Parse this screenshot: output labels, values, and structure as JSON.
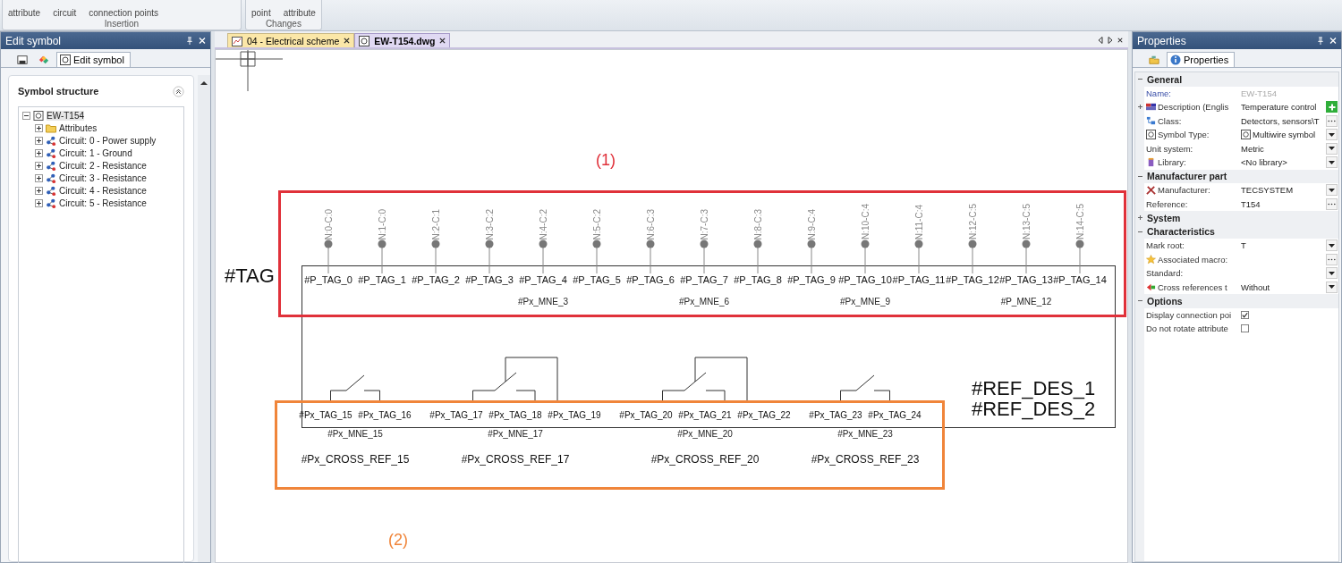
{
  "ribbon": {
    "groups": [
      {
        "label": "Insertion",
        "buttons": [
          "attribute",
          "circuit",
          "connection points"
        ]
      },
      {
        "label": "Changes",
        "buttons": [
          "point",
          "attribute"
        ]
      }
    ]
  },
  "edit_panel": {
    "title": "Edit symbol",
    "tabs": [
      {
        "kind": "disk",
        "selected": false
      },
      {
        "kind": "palette",
        "selected": false
      },
      {
        "kind": "edit",
        "label": "Edit symbol",
        "selected": true
      }
    ],
    "structure_title": "Symbol structure",
    "tree": [
      {
        "label": "EW-T154",
        "kind": "symbol",
        "expanded": true,
        "selected": true,
        "children": [
          {
            "label": "Attributes",
            "kind": "folder",
            "expanded": false,
            "selected": false
          },
          {
            "label": "Circuit: 0 - Power supply",
            "kind": "circuit",
            "expanded": false,
            "selected": false
          },
          {
            "label": "Circuit: 1 - Ground",
            "kind": "circuit",
            "expanded": false,
            "selected": false
          },
          {
            "label": "Circuit: 2 - Resistance",
            "kind": "circuit",
            "expanded": false,
            "selected": false
          },
          {
            "label": "Circuit: 3 - Resistance",
            "kind": "circuit",
            "expanded": false,
            "selected": false
          },
          {
            "label": "Circuit: 4 - Resistance",
            "kind": "circuit",
            "expanded": false,
            "selected": false
          },
          {
            "label": "Circuit: 5 - Resistance",
            "kind": "circuit",
            "expanded": false,
            "selected": false
          }
        ]
      }
    ]
  },
  "document_tabs": [
    {
      "label": "04 - Electrical scheme",
      "kind": "scheme",
      "selected": false
    },
    {
      "label": "EW-T154.dwg",
      "kind": "symbol",
      "selected": true
    }
  ],
  "canvas": {
    "highlights": [
      {
        "label": "(1)",
        "color": "#e0313a"
      },
      {
        "label": "(2)",
        "color": "#f0853a"
      }
    ],
    "tag_label": "#TAG",
    "pin_groups": [
      {
        "pins": [
          {
            "node": "N:0-C:0",
            "tag": "#P_TAG_0"
          },
          {
            "node": "N:1-C:0",
            "tag": "#P_TAG_1"
          },
          {
            "node": "N:2-C:1",
            "tag": "#P_TAG_2"
          }
        ]
      },
      {
        "mne": "#Px_MNE_3",
        "pins": [
          {
            "node": "N:3-C:2",
            "tag": "#P_TAG_3"
          },
          {
            "node": "N:4-C:2",
            "tag": "#P_TAG_4"
          },
          {
            "node": "N:5-C:2",
            "tag": "#P_TAG_5"
          }
        ]
      },
      {
        "mne": "#Px_MNE_6",
        "pins": [
          {
            "node": "N:6-C:3",
            "tag": "#P_TAG_6"
          },
          {
            "node": "N:7-C:3",
            "tag": "#P_TAG_7"
          },
          {
            "node": "N:8-C:3",
            "tag": "#P_TAG_8"
          }
        ]
      },
      {
        "mne": "#Px_MNE_9",
        "pins": [
          {
            "node": "N:9-C:4",
            "tag": "#P_TAG_9"
          },
          {
            "node": "N:10-C:4",
            "tag": "#P_TAG_10"
          },
          {
            "node": "N:11-C:4",
            "tag": "#P_TAG_11"
          }
        ]
      },
      {
        "mne": "#P_MNE_12",
        "pins": [
          {
            "node": "N:12-C:5",
            "tag": "#P_TAG_12"
          },
          {
            "node": "N:13-C:5",
            "tag": "#P_TAG_13"
          },
          {
            "node": "N:14-C:5",
            "tag": "#P_TAG_14"
          }
        ]
      }
    ],
    "contacts": [
      {
        "kind": "simple",
        "tags": [
          "#Px_TAG_15",
          "#Px_TAG_16"
        ],
        "mne": "#Px_MNE_15",
        "cross_ref": "#Px_CROSS_REF_15"
      },
      {
        "kind": "boxed",
        "tags": [
          "#Px_TAG_17",
          "#Px_TAG_18",
          "#Px_TAG_19"
        ],
        "mne": "#Px_MNE_17",
        "cross_ref": "#Px_CROSS_REF_17"
      },
      {
        "kind": "boxed",
        "tags": [
          "#Px_TAG_20",
          "#Px_TAG_21",
          "#Px_TAG_22"
        ],
        "mne": "#Px_MNE_20",
        "cross_ref": "#Px_CROSS_REF_20"
      },
      {
        "kind": "simple",
        "tags": [
          "#Px_TAG_23",
          "#Px_TAG_24"
        ],
        "mne": "#Px_MNE_23",
        "cross_ref": "#Px_CROSS_REF_23"
      }
    ],
    "ref_des": [
      "#REF_DES_1",
      "#REF_DES_2"
    ]
  },
  "properties": {
    "title": "Properties",
    "tabs": [
      {
        "kind": "folders",
        "selected": false
      },
      {
        "kind": "info",
        "label": "Properties",
        "selected": true
      }
    ],
    "sections": [
      {
        "label": "General",
        "expanded": true,
        "rows": [
          {
            "label": "Name:",
            "value": "EW-T154",
            "kind": "readonly"
          },
          {
            "label": "Description (Englis",
            "value": "Temperature control",
            "kind": "add",
            "expanded": false
          },
          {
            "label": "Class:",
            "value": "Detectors, sensors\\T",
            "kind": "browse"
          },
          {
            "label": "Symbol Type:",
            "value": "Multiwire symbol",
            "kind": "dropdown"
          },
          {
            "label": "Unit system:",
            "value": "Metric",
            "kind": "dropdown"
          },
          {
            "label": "Library:",
            "value": "<No library>",
            "kind": "dropdown"
          }
        ]
      },
      {
        "label": "Manufacturer part",
        "expanded": true,
        "rows": [
          {
            "label": "Manufacturer:",
            "value": "TECSYSTEM",
            "kind": "dropdown"
          },
          {
            "label": "Reference:",
            "value": "T154",
            "kind": "browse"
          }
        ]
      },
      {
        "label": "System",
        "expanded": false
      },
      {
        "label": "Characteristics",
        "expanded": true,
        "rows": [
          {
            "label": "Mark root:",
            "value": "T",
            "kind": "dropdown"
          },
          {
            "label": "Associated macro:",
            "kind": "browse"
          },
          {
            "label": "Standard:",
            "kind": "dropdown"
          },
          {
            "label": "Cross references t",
            "value": "Without",
            "kind": "dropdown"
          }
        ]
      },
      {
        "label": "Options",
        "expanded": true,
        "rows": [
          {
            "label": "Display connection poi",
            "kind": "checkbox",
            "checked": true
          },
          {
            "label": "Do not rotate attribute",
            "kind": "checkbox",
            "checked": false
          }
        ]
      }
    ]
  }
}
